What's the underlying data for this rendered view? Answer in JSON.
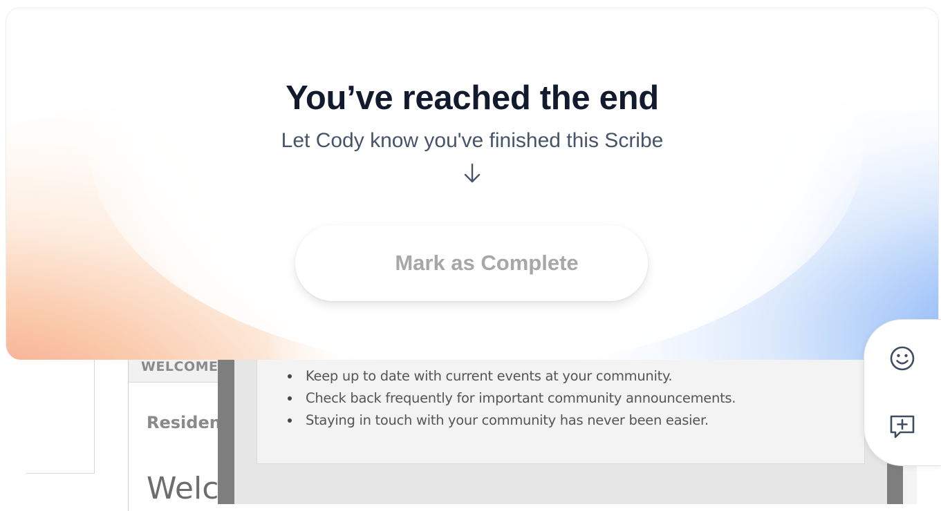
{
  "end_card": {
    "title": "You’ve reached the end",
    "subtitle": "Let Cody know you've finished this Scribe",
    "arrow_icon": "arrow-down-icon",
    "complete_button": "Mark as Complete"
  },
  "side_actions": {
    "reaction_icon": "smiley-face-icon",
    "comment_icon": "add-comment-icon"
  },
  "background_page": {
    "tab_label": "WELCOME",
    "sidebar_heading": "Residents",
    "page_heading": "Welco",
    "bullets": [
      "Keep up to date with current events at your community.",
      "Check back frequently for important community announcements.",
      "Staying in touch with your community has never been easier."
    ]
  },
  "colors": {
    "title": "#121a2e",
    "subtitle": "#46546a",
    "button_text": "#a7a7a7",
    "warm_gradient": "#f7987e",
    "cool_gradient": "#6fa0f4"
  }
}
